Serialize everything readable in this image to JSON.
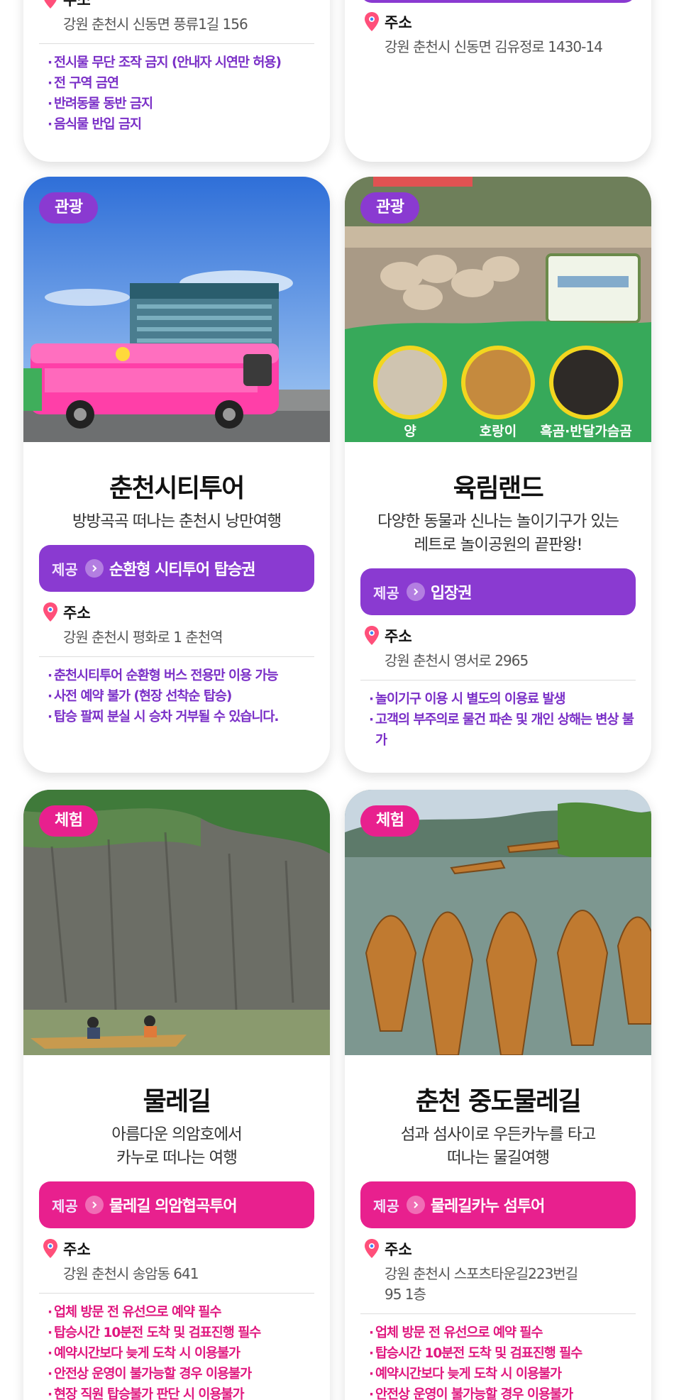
{
  "top_left": {
    "address_label": "주소",
    "address": "강원 춘천시 신동면 풍류1길 156",
    "notes": [
      "전시물 무단 조작 금지 (안내자 시연만 허용)",
      "전 구역 금연",
      "반려동물 동반 금지",
      "음식물 반입 금지"
    ]
  },
  "top_right": {
    "address_label": "주소",
    "address": "강원 춘천시 신동면 김유정로 1430-14"
  },
  "cards": [
    {
      "badge": "관광",
      "photo_labels": [],
      "title": "춘천시티투어",
      "subtitle": [
        "방방곡곡 떠나는 춘천시 낭만여행"
      ],
      "offer_label": "제공",
      "offer_value": "순환형 시티투어 탑승권",
      "address_label": "주소",
      "address": [
        "강원 춘천시 평화로 1 춘천역"
      ],
      "notes": [
        "춘천시티투어 순환형 버스 전용만 이용 가능",
        "사전 예약 불가 (현장 선착순 탑승)",
        "탑승 팔찌 분실 시 승차 거부될 수 있습니다."
      ]
    },
    {
      "badge": "관광",
      "photo_labels": [
        "양",
        "호랑이",
        "흑곰·반달가슴곰"
      ],
      "title": "육림랜드",
      "subtitle": [
        "다양한 동물과 신나는 놀이기구가 있는",
        "레트로 놀이공원의 끝판왕!"
      ],
      "offer_label": "제공",
      "offer_value": "입장권",
      "address_label": "주소",
      "address": [
        "강원 춘천시 영서로 2965"
      ],
      "notes": [
        "놀이기구 이용 시 별도의 이용료 발생",
        "고객의 부주의로 물건 파손 및 개인 상해는 변상 불가"
      ]
    },
    {
      "badge": "체험",
      "photo_labels": [],
      "title": "물레길",
      "subtitle": [
        "아름다운 의암호에서",
        "카누로 떠나는 여행"
      ],
      "offer_label": "제공",
      "offer_value": "물레길 의암협곡투어",
      "address_label": "주소",
      "address": [
        "강원 춘천시 송암동 641"
      ],
      "notes": [
        "업체 방문 전 유선으로 예약 필수",
        "탑승시간 10분전 도착 및 검표진행 필수",
        "예약시간보다 늦게 도착 시 이용불가",
        "안전상 운영이 불가능할 경우 이용불가",
        "현장 직원 탑승불가 판단 시 이용불가"
      ]
    },
    {
      "badge": "체험",
      "photo_labels": [],
      "title": "춘천 중도물레길",
      "subtitle": [
        "섬과 섬사이로 우든카누를 타고",
        "떠나는 물길여행"
      ],
      "offer_label": "제공",
      "offer_value": "물레길카누 섬투어",
      "address_label": "주소",
      "address": [
        "강원 춘천시 스포츠타운길223번길",
        "95 1층"
      ],
      "notes": [
        "업체 방문 전 유선으로 예약 필수",
        "탑승시간 10분전 도착 및 검표진행 필수",
        "예약시간보다 늦게 도착 시 이용불가",
        "안전상 운영이 불가능할 경우 이용불가"
      ]
    }
  ],
  "colors": {
    "purple": "#8a3ad1",
    "pink": "#e8208e"
  }
}
